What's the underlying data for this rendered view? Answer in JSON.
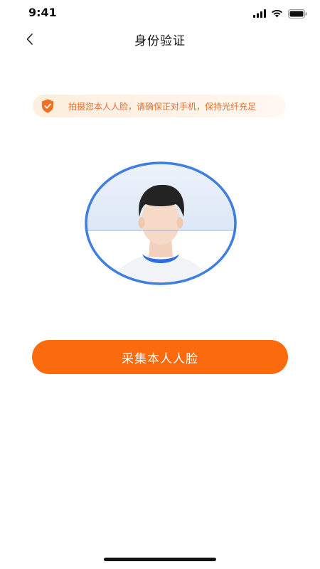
{
  "status_bar": {
    "time": "9:41",
    "icons": [
      "signal-icon",
      "wifi-icon",
      "battery-icon"
    ]
  },
  "nav": {
    "title": "身份验证",
    "back_icon": "chevron-left-icon"
  },
  "tip": {
    "icon": "shield-check-icon",
    "text": "拍摄您本人人脸，请确保正对手机，保持光纤充足"
  },
  "face_capture": {
    "illustration": "face-outline-illustration"
  },
  "action": {
    "capture_label": "采集本人人脸"
  },
  "colors": {
    "accent": "#fb6a0c",
    "tip_text": "#e0723a",
    "tip_bg": "#fdeede",
    "frame_blue": "#3f7fe0"
  }
}
